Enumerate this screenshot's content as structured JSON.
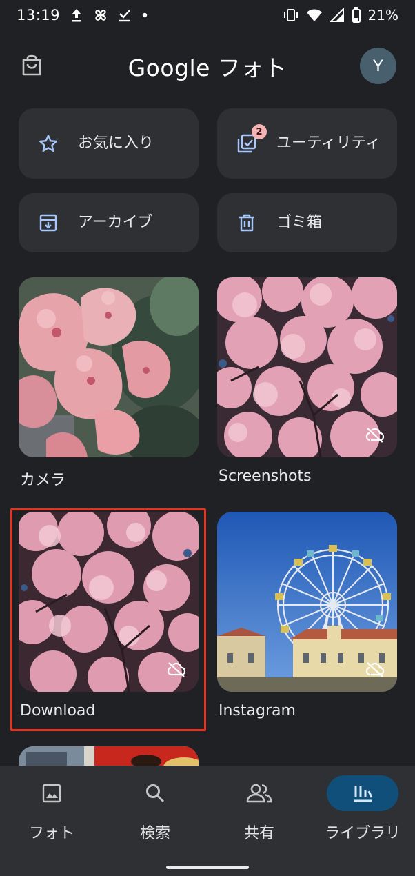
{
  "status_bar": {
    "time": "13:19",
    "battery": "21%",
    "icons": [
      "upload-icon",
      "pinwheel-icon",
      "download-done-icon",
      "dot-icon",
      "vibrate-icon",
      "wifi-icon",
      "signal-icon",
      "battery-icon"
    ]
  },
  "header": {
    "title": "Google フォト",
    "avatar_initial": "Y",
    "shop_icon": "shopping-bag-icon"
  },
  "tiles": [
    {
      "label": "お気に入り",
      "icon": "star-icon"
    },
    {
      "label": "ユーティリティ",
      "icon": "utilities-icon",
      "badge": "2"
    },
    {
      "label": "アーカイブ",
      "icon": "archive-icon"
    },
    {
      "label": "ゴミ箱",
      "icon": "trash-icon"
    }
  ],
  "albums": [
    {
      "label": "カメラ",
      "backed_up": true
    },
    {
      "label": "Screenshots",
      "backed_up": false
    },
    {
      "label": "Download",
      "backed_up": false,
      "selected": true
    },
    {
      "label": "Instagram",
      "backed_up": false
    }
  ],
  "bottom_nav": [
    {
      "label": "フォト",
      "icon": "photo-icon",
      "active": false
    },
    {
      "label": "検索",
      "icon": "search-icon",
      "active": false
    },
    {
      "label": "共有",
      "icon": "people-icon",
      "active": false
    },
    {
      "label": "ライブラリ",
      "icon": "library-icon",
      "active": true
    }
  ],
  "colors": {
    "background": "#202124",
    "tile": "#2e3034",
    "accent_icon": "#a8c7fa",
    "active_nav": "#0f4f7a",
    "selection": "#e8321e"
  }
}
